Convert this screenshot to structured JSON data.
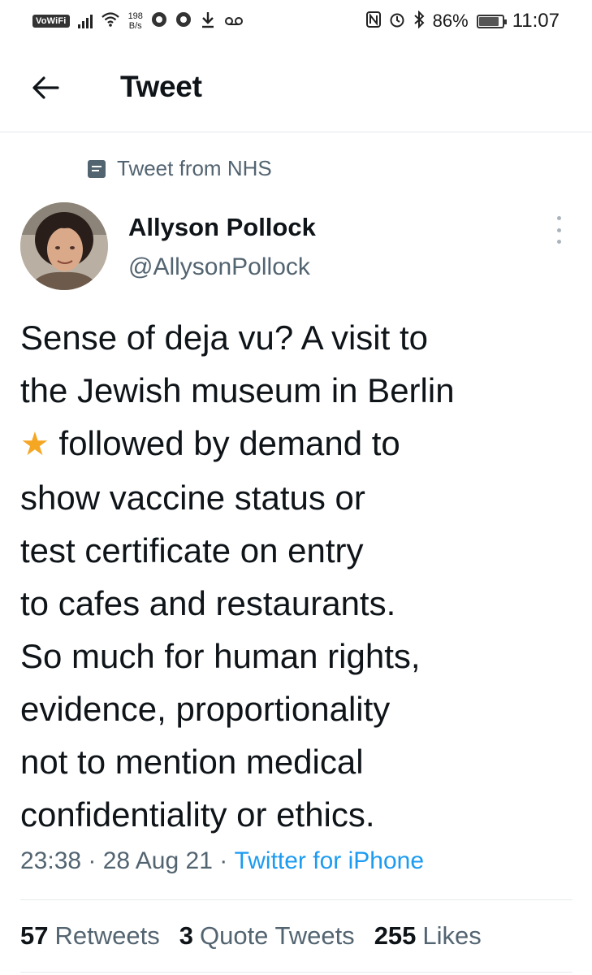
{
  "status_bar": {
    "vowifi": "VoWiFi",
    "net_speed_value": "198",
    "net_speed_unit": "B/s",
    "battery_percent": "86%",
    "time": "11:07"
  },
  "header": {
    "title": "Tweet"
  },
  "tweet": {
    "source_label": "Tweet from NHS",
    "author_name": "Allyson Pollock",
    "author_handle": "@AllysonPollock",
    "text_line1": "Sense of deja vu? A visit to",
    "text_line2": "the Jewish museum in Berlin",
    "text_star": "★",
    "text_line3": " followed by demand  to",
    "text_rest": "show vaccine status or\ntest certificate on entry\nto cafes and restaurants.\nSo much for human rights,\nevidence, proportionality\nnot to mention medical\nconfidentiality or ethics.",
    "time": "23:38",
    "date": "28 Aug 21",
    "separator": " · ",
    "client": "Twitter for iPhone"
  },
  "stats": {
    "retweets_count": "57",
    "retweets_label": "Retweets",
    "quotes_count": "3",
    "quotes_label": "Quote Tweets",
    "likes_count": "255",
    "likes_label": "Likes"
  },
  "colors": {
    "accent": "#1d9bf0",
    "secondary_text": "#536471",
    "star": "#f5a623"
  }
}
